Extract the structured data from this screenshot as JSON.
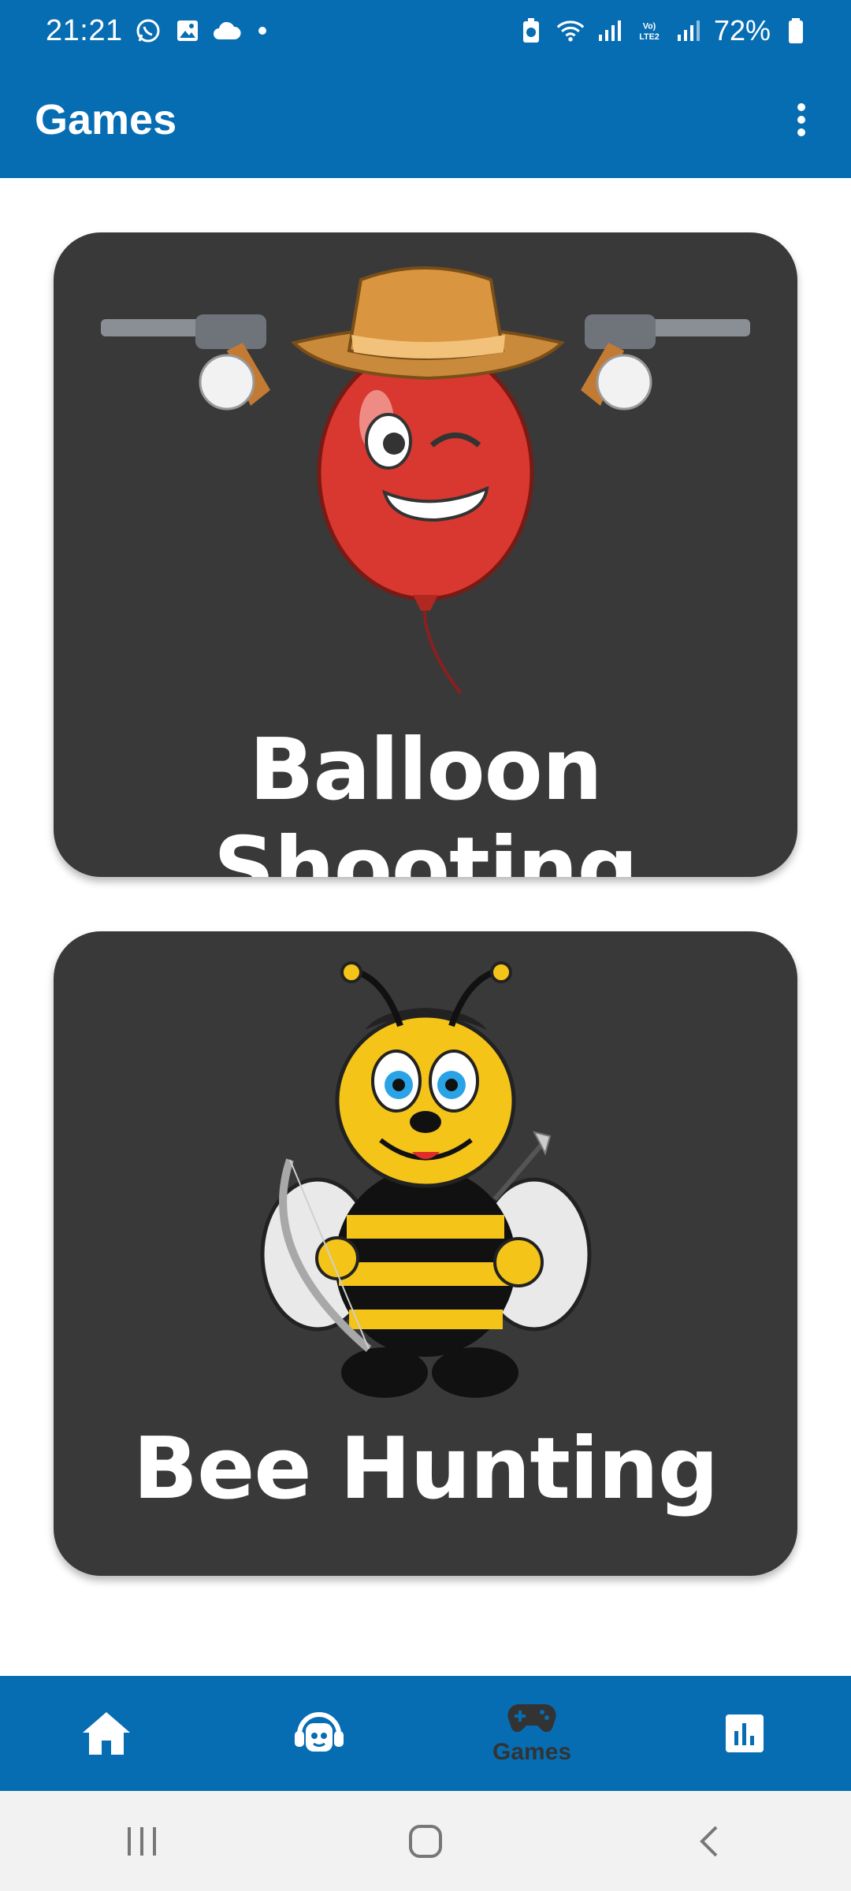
{
  "status_bar": {
    "time": "21:21",
    "battery": "72%",
    "icons": [
      "whatsapp-icon",
      "gallery-icon",
      "cloud-icon",
      "dot-icon",
      "data-saver-icon",
      "wifi-icon",
      "signal-icon",
      "volte-icon",
      "signal-icon",
      "battery-icon"
    ],
    "lte_label": "Vo)\nLTE2"
  },
  "app_bar": {
    "title": "Games",
    "menu_icon": "more-vert-icon"
  },
  "games": [
    {
      "title": "Balloon Shooting",
      "art": "cowboy-balloon-illustration"
    },
    {
      "title": "Bee Hunting",
      "art": "archer-bee-illustration"
    }
  ],
  "bottom_nav": {
    "items": [
      {
        "icon": "home-icon",
        "label": ""
      },
      {
        "icon": "headset-bot-icon",
        "label": ""
      },
      {
        "icon": "gamepad-icon",
        "label": "Games",
        "active": true
      },
      {
        "icon": "bar-chart-icon",
        "label": ""
      }
    ]
  },
  "colors": {
    "primary": "#066db3",
    "card": "#393939",
    "active_nav": "#333333"
  }
}
